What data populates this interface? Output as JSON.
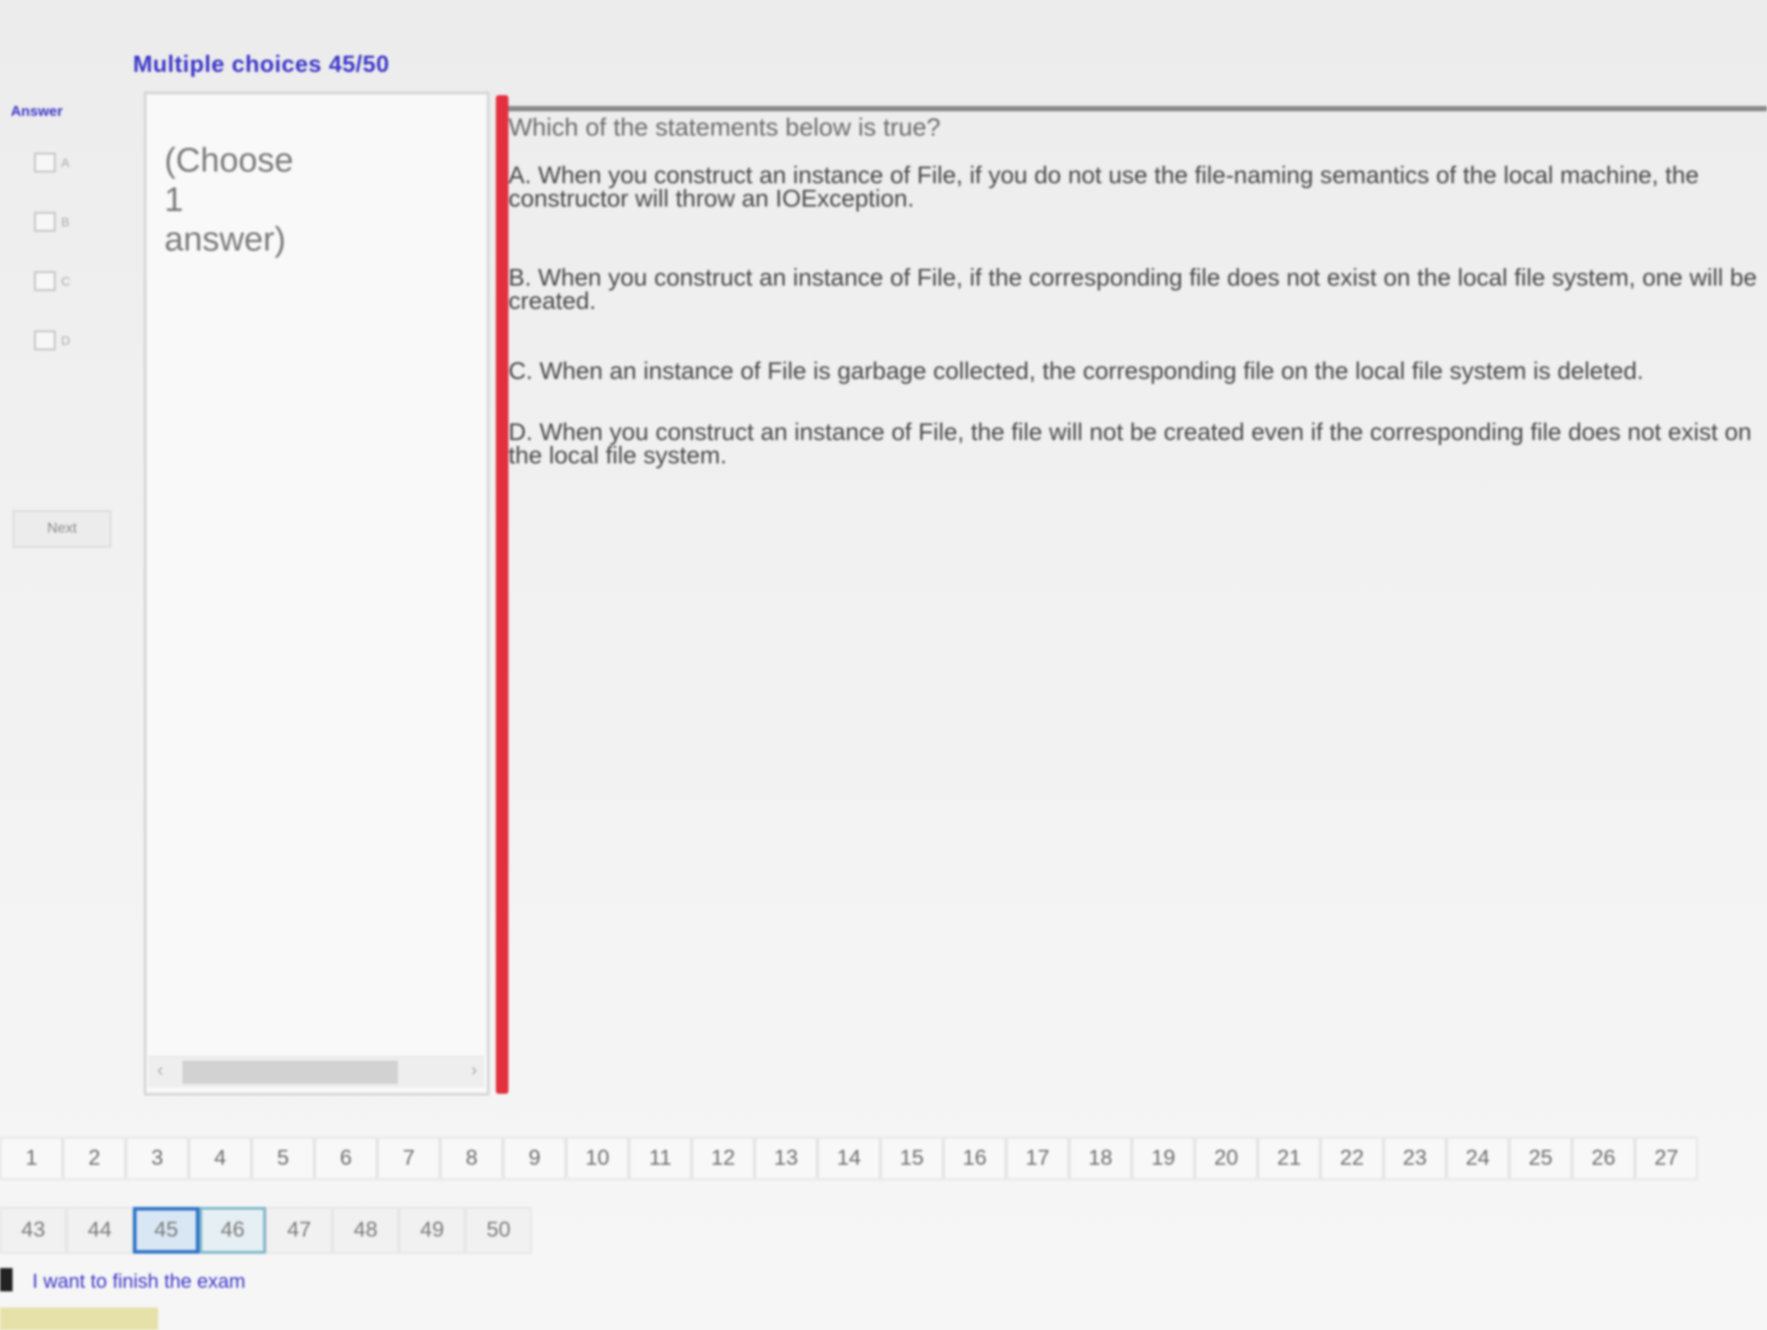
{
  "header": {
    "title": "Multiple choices 45/50"
  },
  "sidebar": {
    "answer_label": "Answer",
    "choices": [
      {
        "letter": "A"
      },
      {
        "letter": "B"
      },
      {
        "letter": "C"
      },
      {
        "letter": "D"
      }
    ],
    "next_label": "Next"
  },
  "answer_panel": {
    "hint": "(Choose 1 answer)"
  },
  "question": {
    "text": "Which of the statements below is true?",
    "options": [
      {
        "text": "A. When you construct an instance of File, if you do not use the file-naming semantics of the local machine, the constructor will throw an IOException."
      },
      {
        "text": "B. When you construct an instance of File, if the corresponding file does not exist on the local file system, one will be created."
      },
      {
        "text": "C. When an instance of File is garbage collected, the corresponding file on the local file system is deleted."
      },
      {
        "text": "D. When you construct an instance of File, the file will not be created even if the corresponding file does not exist on the local file system."
      }
    ]
  },
  "nav_row1": [
    "1",
    "2",
    "3",
    "4",
    "5",
    "6",
    "7",
    "8",
    "9",
    "10",
    "11",
    "12",
    "13",
    "14",
    "15",
    "16",
    "17",
    "18",
    "19",
    "20",
    "21",
    "22",
    "23",
    "24",
    "25",
    "26",
    "27"
  ],
  "nav_row2": [
    "43",
    "44",
    "45",
    "46",
    "47",
    "48",
    "49",
    "50"
  ],
  "nav_current": "45",
  "nav_selected": "46",
  "finish": {
    "label": "I want to finish the exam"
  },
  "colors": {
    "accent": "#3b35c8",
    "splitter": "#e2303f",
    "current_border": "#2f74c8"
  }
}
